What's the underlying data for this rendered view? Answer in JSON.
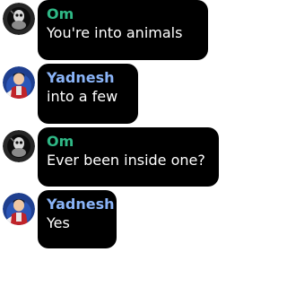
{
  "chat": {
    "messages": [
      {
        "author": "Om",
        "author_color": "#2fb886",
        "avatar_icon": "robot-dark-avatar-icon",
        "text": "You're into animals"
      },
      {
        "author": "Yadnesh",
        "author_color": "#8ab4f8",
        "avatar_icon": "anime-character-avatar-icon",
        "text": "into a few"
      },
      {
        "author": "Om",
        "author_color": "#2fb886",
        "avatar_icon": "robot-dark-avatar-icon",
        "text": "Ever been inside one?"
      },
      {
        "author": "Yadnesh",
        "author_color": "#8ab4f8",
        "avatar_icon": "anime-character-avatar-icon",
        "text": "Yes"
      }
    ]
  }
}
